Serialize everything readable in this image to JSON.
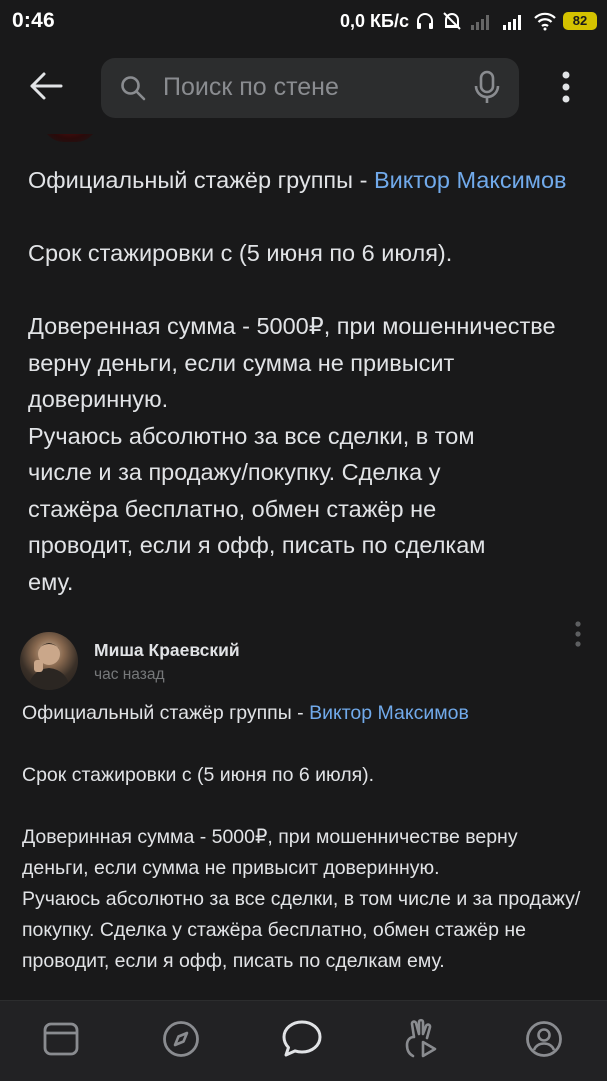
{
  "status_bar": {
    "time": "0:46",
    "network_speed": "0,0 КБ/с",
    "battery_level": "82",
    "battery_color": "#d4c200"
  },
  "header": {
    "back_icon": "arrow-left-icon",
    "search": {
      "placeholder": "Поиск по стене",
      "search_icon": "search-icon",
      "mic_icon": "microphone-icon"
    },
    "more_icon": "more-vertical-icon"
  },
  "posts": [
    {
      "lines": {
        "intro_prefix": "Официальный стажёр группы - ",
        "intro_link": "Виктор Максимов",
        "period": "Срок стажировки с (5 июня по 6 июля).",
        "trust": "Доверенная сумма - 5000₽, при мошенничестве верну деньги, если сумма не привысит доверинную.",
        "vouch": "Ручаюсь абсолютно за все сделки, в том числе и за продажу/покупку. Сделка у стажёра бесплатно, обмен стажёр не проводит, если я офф, писать по сделкам ему."
      }
    },
    {
      "author": "Миша Краевский",
      "time": "час назад",
      "lines": {
        "intro_prefix": "Официальный стажёр группы - ",
        "intro_link": "Виктор Максимов",
        "period": "Срок стажировки с (5 июня по 6 июля).",
        "trust": "Доверинная сумма - 5000₽, при мошенничестве верну деньги, если сумма не привысит доверинную.",
        "vouch": "Ручаюсь абсолютно за все сделки, в том числе и за продажу/покупку. Сделка у стажёра бесплатно, обмен стажёр не проводит, если я офф, писать по сделкам ему."
      }
    }
  ],
  "bottom_nav": {
    "items": [
      "news-feed-icon",
      "discover-compass-icon",
      "messages-icon",
      "clips-icon",
      "profile-icon"
    ],
    "active_index": 2
  },
  "colors": {
    "background": "#19191a",
    "text": "#e1e3e6",
    "link": "#71aaeb",
    "secondary": "#76787a",
    "nav_bg": "#222224"
  }
}
